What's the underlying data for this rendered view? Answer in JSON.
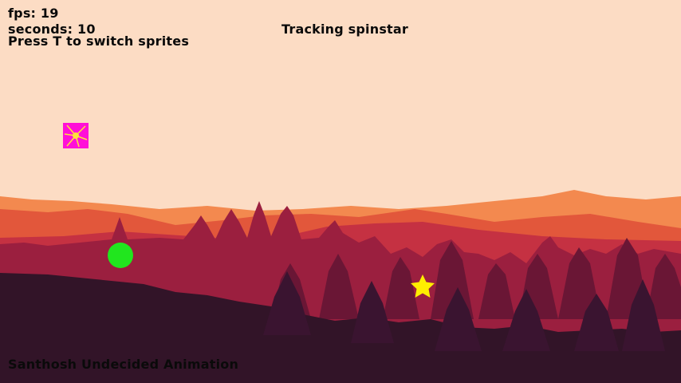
{
  "hud": {
    "fps_label": "fps: 19",
    "seconds_label": "seconds: 10",
    "hint": "Press T to switch sprites",
    "tracking": "Tracking spinstar"
  },
  "footer": {
    "credit": "Santhosh Undecided Animation"
  },
  "sprites": [
    {
      "name": "spin-square",
      "color": "#ff10d8",
      "accent": "#ffe23a"
    },
    {
      "name": "green-ball",
      "color": "#21e61e"
    },
    {
      "name": "spinstar",
      "color": "#ffee00"
    }
  ],
  "colors": {
    "sky": "#fcdcc4",
    "far_hills": "#f3894f",
    "mid_hills": "#e2573b",
    "near_trees": "#9b1f3f",
    "foreground": "#321428"
  }
}
